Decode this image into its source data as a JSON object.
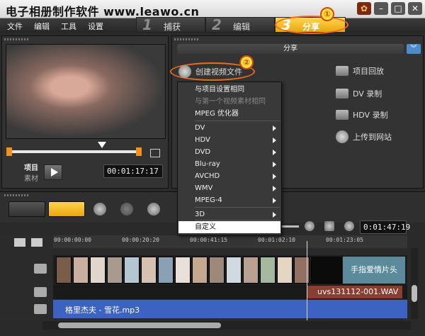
{
  "window": {
    "title": "电子相册制作软件 www.leawo.cn"
  },
  "menu": [
    "文件",
    "编辑",
    "工具",
    "设置"
  ],
  "steps": [
    {
      "num": "1",
      "label": "捕获"
    },
    {
      "num": "2",
      "label": "编辑"
    },
    {
      "num": "3",
      "label": "分享"
    }
  ],
  "callouts": [
    "①",
    "②"
  ],
  "preview": {
    "mode_project": "项目",
    "mode_clip": "素材",
    "timecode": "00:01:17:17"
  },
  "share": {
    "header": "分享",
    "create_video": "创建视频文件",
    "right_items": [
      "项目回放",
      "DV 录制",
      "HDV 录制",
      "上传到网站"
    ]
  },
  "dropdown": {
    "items": [
      {
        "label": "与项目设置相同",
        "disabled": false,
        "submenu": false
      },
      {
        "label": "与第一个视频素材相同",
        "disabled": true,
        "submenu": false
      },
      {
        "label": "MPEG 优化器",
        "disabled": false,
        "submenu": false
      },
      {
        "label": "DV",
        "disabled": false,
        "submenu": true
      },
      {
        "label": "HDV",
        "disabled": false,
        "submenu": true
      },
      {
        "label": "DVD",
        "disabled": false,
        "submenu": true
      },
      {
        "label": "Blu-ray",
        "disabled": false,
        "submenu": true
      },
      {
        "label": "AVCHD",
        "disabled": false,
        "submenu": true
      },
      {
        "label": "WMV",
        "disabled": false,
        "submenu": true
      },
      {
        "label": "MPEG-4",
        "disabled": false,
        "submenu": true
      },
      {
        "label": "3D",
        "disabled": false,
        "submenu": true
      },
      {
        "label": "自定义",
        "disabled": false,
        "submenu": false,
        "highlighted": true
      }
    ]
  },
  "timeline": {
    "duration": "0:01:47:19",
    "ruler": [
      "00:00:00:00",
      "00:00:20:20",
      "00:00:41:15",
      "00:01:02:10",
      "00:01:23:05"
    ],
    "title_clip": "手指爱情片头",
    "wav_clip": "uvs131112-001.WAV",
    "music_clip": "格里杰夫 - 雪花.mp3"
  }
}
